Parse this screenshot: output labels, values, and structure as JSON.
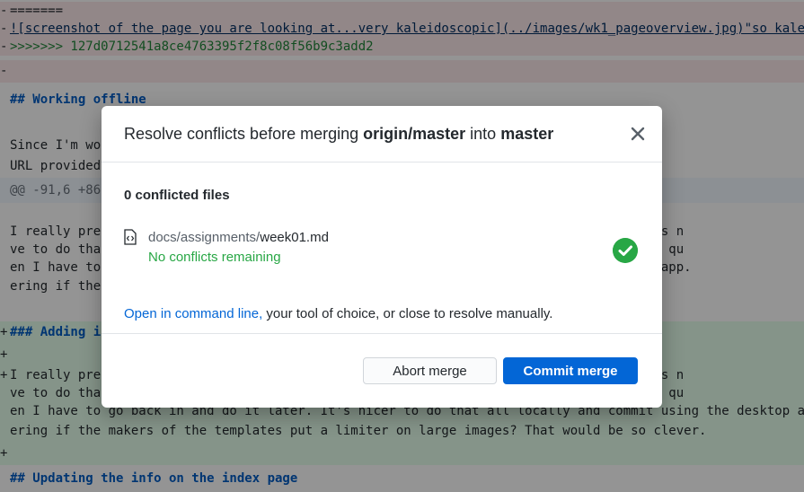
{
  "diff": {
    "lines": [
      {
        "prefix": "-",
        "text": "=======",
        "style": "red"
      },
      {
        "prefix": "-",
        "text": "![screenshot of the page you are looking at...very kaleidoscopic](../images/wk1_pageoverview.jpg)\"so kaleido",
        "style": "red",
        "kind": "link"
      },
      {
        "prefix": "-",
        "text": ">>>>>>> 127d0712541a8ce4763395f2f8c08f56b9c3add2",
        "style": "red",
        "kind": "conflict"
      },
      {
        "prefix": "-",
        "text": "",
        "style": "red"
      },
      {
        "prefix": " ",
        "text": "## Working offline",
        "style": "plain",
        "kind": "heading"
      },
      {
        "prefix": "",
        "text": "",
        "style": "plain"
      },
      {
        "prefix": " ",
        "text": "Since I'm working offline I also tried cloning my repo. I also tried cloning m",
        "style": "plain"
      },
      {
        "prefix": " ",
        "text": "URL provided",
        "style": "plain"
      },
      {
        "prefix": "",
        "text": "@@ -91,6 +86,                                                         ltaneous p",
        "style": "hunk"
      },
      {
        "prefix": "",
        "text": "",
        "style": "plain"
      },
      {
        "prefix": " ",
        "text": "I really prefer                                                      er now that images n",
        "style": "plain"
      },
      {
        "prefix": "",
        "text": "ve to do that                                                         s fine, but it's qu",
        "style": "plain"
      },
      {
        "prefix": "",
        "text": "en I have to                                                          ing the desktop app.",
        "style": "plain"
      },
      {
        "prefix": "",
        "text": "ering if the m                                                        lever.",
        "style": "plain"
      },
      {
        "prefix": "",
        "text": "",
        "style": "plain"
      },
      {
        "prefix": "+",
        "text": "### Adding i",
        "style": "green",
        "kind": "heading"
      },
      {
        "prefix": "+",
        "text": "",
        "style": "green"
      },
      {
        "prefix": "+",
        "text": "I really pre                                                         er now that images n",
        "style": "green"
      },
      {
        "prefix": "",
        "text": "ve to do that                                                         s fine, but it's qu",
        "style": "green"
      },
      {
        "prefix": "",
        "text": "en I have to go back in and do it later. It's nicer to do that all locally and commit using the desktop app.",
        "style": "green"
      },
      {
        "prefix": "",
        "text": "ering if the makers of the templates put a limiter on large images? That would be so clever.",
        "style": "green"
      },
      {
        "prefix": "+",
        "text": "",
        "style": "green"
      },
      {
        "prefix": " ",
        "text": "## Updating the info on the index page",
        "style": "plain",
        "kind": "heading"
      }
    ]
  },
  "modal": {
    "title_prefix": "Resolve conflicts before merging ",
    "source_branch": "origin/master",
    "title_mid": " into ",
    "target_branch": "master",
    "close_icon": "close-icon",
    "conflict_count": "0 conflicted files",
    "file": {
      "icon": "code-file-icon",
      "dir": "docs/assignments/",
      "name": "week01.md",
      "status": "No conflicts remaining",
      "status_icon": "check-circle-icon"
    },
    "instructions": {
      "link": "Open in command line,",
      "rest": " your tool of choice, or close to resolve manually."
    },
    "buttons": {
      "abort": "Abort merge",
      "commit": "Commit merge"
    },
    "colors": {
      "accent": "#0366d6",
      "success": "#28a745"
    }
  }
}
